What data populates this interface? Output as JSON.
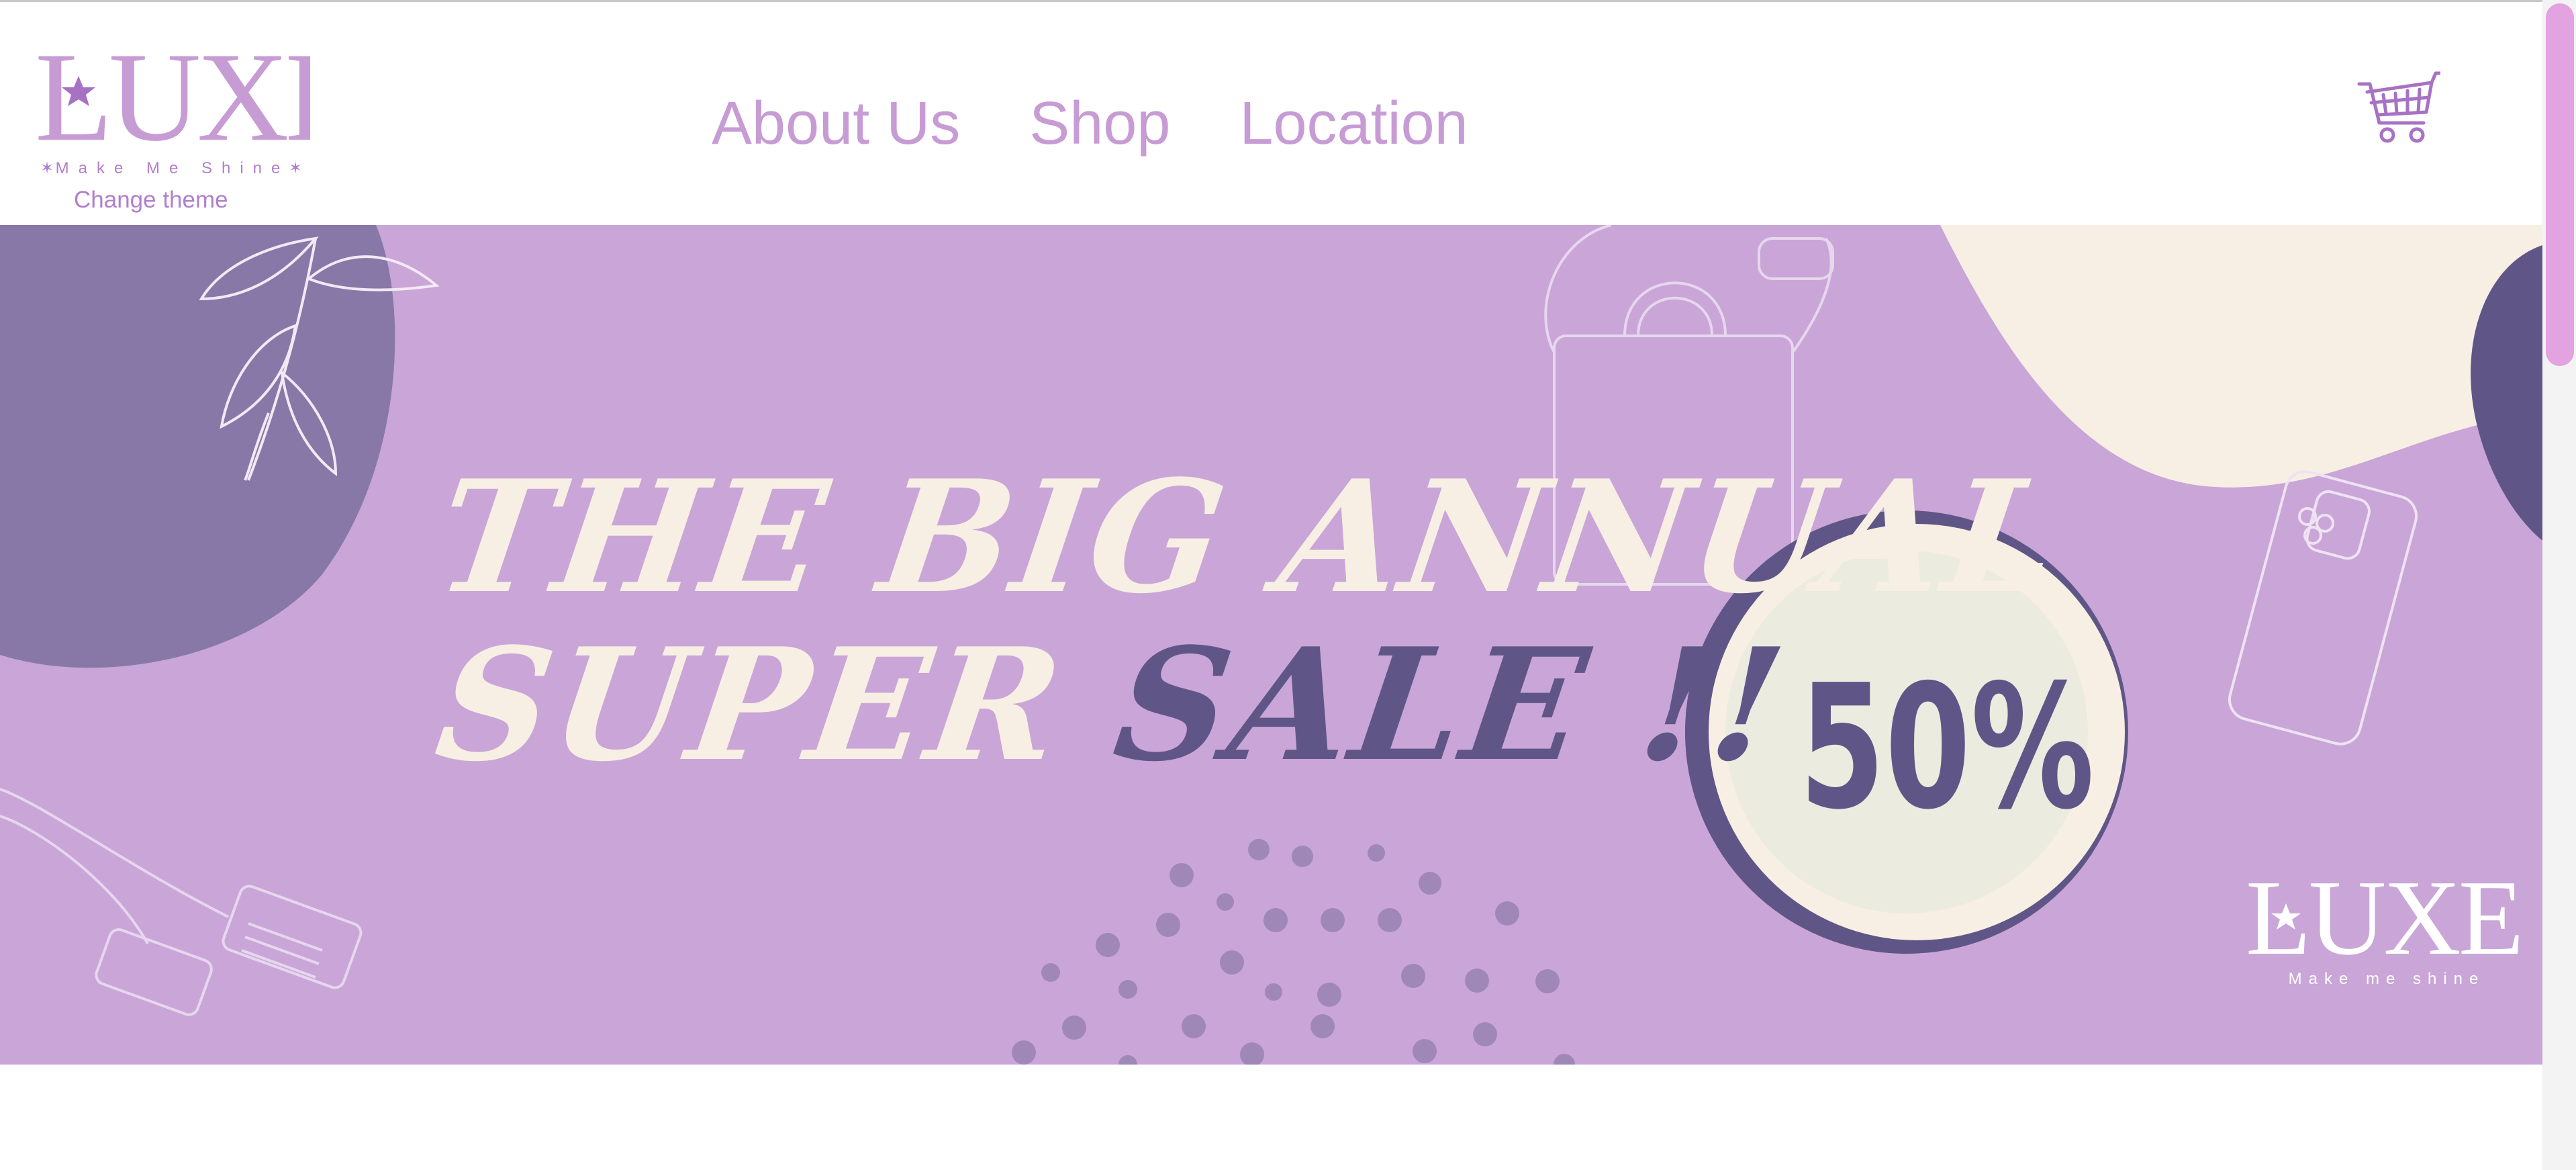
{
  "brand": {
    "name": "LUXE",
    "tagline": "Make Me Shine",
    "change_theme": "Change theme"
  },
  "nav": {
    "items": [
      {
        "label": "About Us"
      },
      {
        "label": "Shop"
      },
      {
        "label": "Location"
      }
    ]
  },
  "cart": {
    "icon": "cart-icon"
  },
  "banner": {
    "headline_line1": "THE BIG ANNUAL",
    "headline_line2_prefix": "SUPER",
    "headline_line2_highlight": "SALE !!",
    "discount": "50%",
    "watermark_brand": "LUXE",
    "watermark_tagline": "Make me shine"
  },
  "colors": {
    "accent": "#c79bd4",
    "banner_bg": "#c9a6d7",
    "dark_purple": "#5f5687",
    "cream": "#f7efe3",
    "scroll_thumb": "#e3a2e0"
  }
}
